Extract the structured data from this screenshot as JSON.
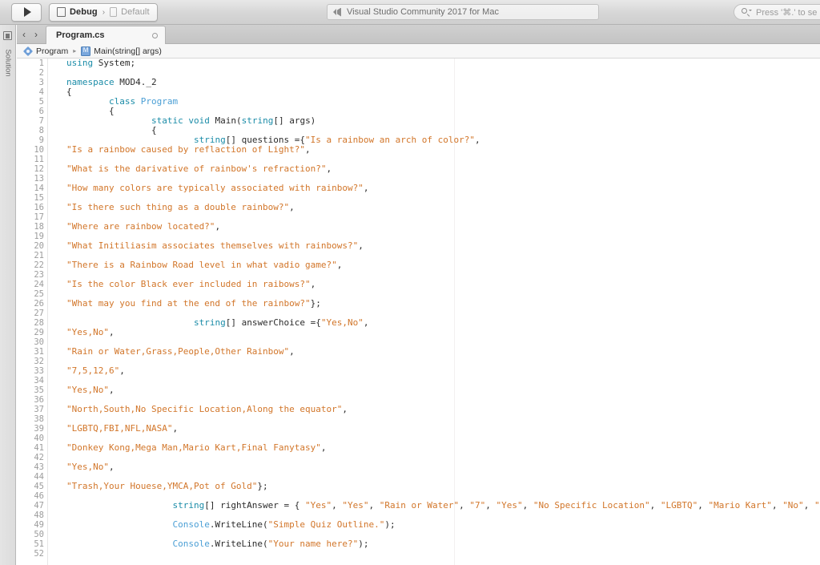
{
  "toolbar": {
    "run_button": "run-button",
    "config_label": "Debug",
    "config_separator": "›",
    "device_label": "Default",
    "app_title": "Visual Studio Community 2017 for Mac",
    "search_placeholder": "Press '⌘.' to se"
  },
  "rail": {
    "label": "Solution"
  },
  "tabbar": {
    "back_arrow": "‹",
    "forward_arrow": "›",
    "active_tab": "Program.cs"
  },
  "breadcrumb": {
    "class_name": "Program",
    "separator": "▸",
    "method_name": "Main(string[] args)"
  },
  "editor": {
    "lines": [
      {
        "n": 1,
        "tokens": [
          {
            "t": "using ",
            "c": "kw"
          },
          {
            "t": "System;",
            "c": "pln"
          }
        ],
        "indent": 0
      },
      {
        "n": 2,
        "tokens": [],
        "indent": 0
      },
      {
        "n": 3,
        "tokens": [
          {
            "t": "namespace ",
            "c": "kw"
          },
          {
            "t": "MOD4._2",
            "c": "pln"
          }
        ],
        "indent": 0
      },
      {
        "n": 4,
        "tokens": [
          {
            "t": "{",
            "c": "pln"
          }
        ],
        "indent": 0
      },
      {
        "n": 5,
        "tokens": [
          {
            "t": "class ",
            "c": "kw"
          },
          {
            "t": "Program",
            "c": "cls"
          }
        ],
        "indent": 2
      },
      {
        "n": 6,
        "tokens": [
          {
            "t": "{",
            "c": "pln"
          }
        ],
        "indent": 2
      },
      {
        "n": 7,
        "tokens": [
          {
            "t": "static void ",
            "c": "kw"
          },
          {
            "t": "Main(",
            "c": "pln"
          },
          {
            "t": "string",
            "c": "typ"
          },
          {
            "t": "[] args)",
            "c": "pln"
          }
        ],
        "indent": 4
      },
      {
        "n": 8,
        "tokens": [
          {
            "t": "{",
            "c": "pln"
          }
        ],
        "indent": 4
      },
      {
        "n": 9,
        "tokens": [
          {
            "t": "string",
            "c": "typ"
          },
          {
            "t": "[] questions ={",
            "c": "pln"
          },
          {
            "t": "\"Is a rainbow an arch of color?\"",
            "c": "str"
          },
          {
            "t": ",",
            "c": "pln"
          }
        ],
        "indent": 6
      },
      {
        "n": 10,
        "tokens": [
          {
            "t": "\"Is a rainbow caused by reflaction of Light?\"",
            "c": "str"
          },
          {
            "t": ",",
            "c": "pln"
          }
        ],
        "indent": 0
      },
      {
        "n": 11,
        "tokens": [],
        "indent": 0
      },
      {
        "n": 12,
        "tokens": [
          {
            "t": "\"What is the darivative of rainbow's refraction?\"",
            "c": "str"
          },
          {
            "t": ",",
            "c": "pln"
          }
        ],
        "indent": 0
      },
      {
        "n": 13,
        "tokens": [],
        "indent": 0
      },
      {
        "n": 14,
        "tokens": [
          {
            "t": "\"How many colors are typically associated with rainbow?\"",
            "c": "str"
          },
          {
            "t": ",",
            "c": "pln"
          }
        ],
        "indent": 0
      },
      {
        "n": 15,
        "tokens": [],
        "indent": 0
      },
      {
        "n": 16,
        "tokens": [
          {
            "t": "\"Is there such thing as a double rainbow?\"",
            "c": "str"
          },
          {
            "t": ",",
            "c": "pln"
          }
        ],
        "indent": 0
      },
      {
        "n": 17,
        "tokens": [],
        "indent": 0
      },
      {
        "n": 18,
        "tokens": [
          {
            "t": "\"Where are rainbow located?\"",
            "c": "str"
          },
          {
            "t": ",",
            "c": "pln"
          }
        ],
        "indent": 0
      },
      {
        "n": 19,
        "tokens": [],
        "indent": 0
      },
      {
        "n": 20,
        "tokens": [
          {
            "t": "\"What Initiliasim associates themselves with rainbows?\"",
            "c": "str"
          },
          {
            "t": ",",
            "c": "pln"
          }
        ],
        "indent": 0
      },
      {
        "n": 21,
        "tokens": [],
        "indent": 0
      },
      {
        "n": 22,
        "tokens": [
          {
            "t": "\"There is a Rainbow Road level in what vadio game?\"",
            "c": "str"
          },
          {
            "t": ",",
            "c": "pln"
          }
        ],
        "indent": 0
      },
      {
        "n": 23,
        "tokens": [],
        "indent": 0
      },
      {
        "n": 24,
        "tokens": [
          {
            "t": "\"Is the color Black ever included in raibows?\"",
            "c": "str"
          },
          {
            "t": ",",
            "c": "pln"
          }
        ],
        "indent": 0
      },
      {
        "n": 25,
        "tokens": [],
        "indent": 0
      },
      {
        "n": 26,
        "tokens": [
          {
            "t": "\"What may you find at the end of the rainbow?\"",
            "c": "str"
          },
          {
            "t": "};",
            "c": "pln"
          }
        ],
        "indent": 0
      },
      {
        "n": 27,
        "tokens": [],
        "indent": 0
      },
      {
        "n": 28,
        "tokens": [
          {
            "t": "string",
            "c": "typ"
          },
          {
            "t": "[] answerChoice ={",
            "c": "pln"
          },
          {
            "t": "\"Yes,No\"",
            "c": "str"
          },
          {
            "t": ",",
            "c": "pln"
          }
        ],
        "indent": 6
      },
      {
        "n": 29,
        "tokens": [
          {
            "t": "\"Yes,No\"",
            "c": "str"
          },
          {
            "t": ",",
            "c": "pln"
          }
        ],
        "indent": 0
      },
      {
        "n": 30,
        "tokens": [],
        "indent": 0
      },
      {
        "n": 31,
        "tokens": [
          {
            "t": "\"Rain or Water,Grass,People,Other Rainbow\"",
            "c": "str"
          },
          {
            "t": ",",
            "c": "pln"
          }
        ],
        "indent": 0
      },
      {
        "n": 32,
        "tokens": [],
        "indent": 0
      },
      {
        "n": 33,
        "tokens": [
          {
            "t": "\"7,5,12,6\"",
            "c": "str"
          },
          {
            "t": ",",
            "c": "pln"
          }
        ],
        "indent": 0
      },
      {
        "n": 34,
        "tokens": [],
        "indent": 0
      },
      {
        "n": 35,
        "tokens": [
          {
            "t": "\"Yes,No\"",
            "c": "str"
          },
          {
            "t": ",",
            "c": "pln"
          }
        ],
        "indent": 0
      },
      {
        "n": 36,
        "tokens": [],
        "indent": 0
      },
      {
        "n": 37,
        "tokens": [
          {
            "t": "\"North,South,No Specific Location,Along the equator\"",
            "c": "str"
          },
          {
            "t": ",",
            "c": "pln"
          }
        ],
        "indent": 0
      },
      {
        "n": 38,
        "tokens": [],
        "indent": 0
      },
      {
        "n": 39,
        "tokens": [
          {
            "t": "\"LGBTQ,FBI,NFL,NASA\"",
            "c": "str"
          },
          {
            "t": ",",
            "c": "pln"
          }
        ],
        "indent": 0
      },
      {
        "n": 40,
        "tokens": [],
        "indent": 0
      },
      {
        "n": 41,
        "tokens": [
          {
            "t": "\"Donkey Kong,Mega Man,Mario Kart,Final Fanytasy\"",
            "c": "str"
          },
          {
            "t": ",",
            "c": "pln"
          }
        ],
        "indent": 0
      },
      {
        "n": 42,
        "tokens": [],
        "indent": 0
      },
      {
        "n": 43,
        "tokens": [
          {
            "t": "\"Yes,No\"",
            "c": "str"
          },
          {
            "t": ",",
            "c": "pln"
          }
        ],
        "indent": 0
      },
      {
        "n": 44,
        "tokens": [],
        "indent": 0
      },
      {
        "n": 45,
        "tokens": [
          {
            "t": "\"Trash,Your Houese,YMCA,Pot of Gold\"",
            "c": "str"
          },
          {
            "t": "};",
            "c": "pln"
          }
        ],
        "indent": 0
      },
      {
        "n": 46,
        "tokens": [],
        "indent": 0
      },
      {
        "n": 47,
        "tokens": [
          {
            "t": "string",
            "c": "typ"
          },
          {
            "t": "[] rightAnswer = { ",
            "c": "pln"
          },
          {
            "t": "\"Yes\"",
            "c": "str"
          },
          {
            "t": ", ",
            "c": "pln"
          },
          {
            "t": "\"Yes\"",
            "c": "str"
          },
          {
            "t": ", ",
            "c": "pln"
          },
          {
            "t": "\"Rain or Water\"",
            "c": "str"
          },
          {
            "t": ", ",
            "c": "pln"
          },
          {
            "t": "\"7\"",
            "c": "str"
          },
          {
            "t": ", ",
            "c": "pln"
          },
          {
            "t": "\"Yes\"",
            "c": "str"
          },
          {
            "t": ", ",
            "c": "pln"
          },
          {
            "t": "\"No Specific Location\"",
            "c": "str"
          },
          {
            "t": ", ",
            "c": "pln"
          },
          {
            "t": "\"LGBTQ\"",
            "c": "str"
          },
          {
            "t": ", ",
            "c": "pln"
          },
          {
            "t": "\"Mario Kart\"",
            "c": "str"
          },
          {
            "t": ", ",
            "c": "pln"
          },
          {
            "t": "\"No\"",
            "c": "str"
          },
          {
            "t": ", ",
            "c": "pln"
          },
          {
            "t": "\"Pot of Gold\"",
            "c": "str"
          },
          {
            "t": " };",
            "c": "pln"
          }
        ],
        "indent": 5
      },
      {
        "n": 48,
        "tokens": [],
        "indent": 0
      },
      {
        "n": 49,
        "tokens": [
          {
            "t": "Console",
            "c": "cls"
          },
          {
            "t": ".WriteLine(",
            "c": "pln"
          },
          {
            "t": "\"Simple Quiz Outline.\"",
            "c": "str"
          },
          {
            "t": ");",
            "c": "pln"
          }
        ],
        "indent": 5
      },
      {
        "n": 50,
        "tokens": [],
        "indent": 0
      },
      {
        "n": 51,
        "tokens": [
          {
            "t": "Console",
            "c": "cls"
          },
          {
            "t": ".WriteLine(",
            "c": "pln"
          },
          {
            "t": "\"Your name here?\"",
            "c": "str"
          },
          {
            "t": ");",
            "c": "pln"
          }
        ],
        "indent": 5
      },
      {
        "n": 52,
        "tokens": [],
        "indent": 0
      }
    ]
  }
}
